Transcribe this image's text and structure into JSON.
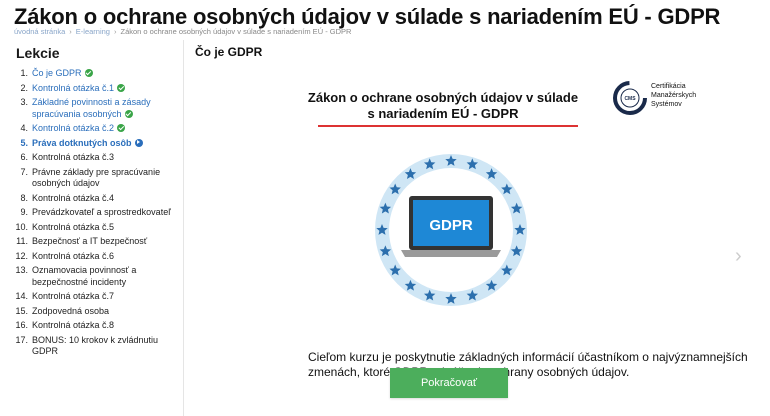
{
  "page": {
    "title": "Zákon o ochrane osobných údajov v súlade s nariadením EÚ - GDPR"
  },
  "breadcrumb": {
    "items": [
      "úvodná stránka",
      "E-learning",
      "Zákon o ochrane osobných údajov v súlade s nariadením EÚ - GDPR"
    ]
  },
  "sidebar": {
    "title": "Lekcie",
    "items": [
      {
        "num": "1.",
        "label": "Čo je GDPR",
        "status": "done"
      },
      {
        "num": "2.",
        "label": "Kontrolná otázka č.1",
        "status": "done"
      },
      {
        "num": "3.",
        "label": "Základné povinnosti a zásady spracúvania osobných",
        "status": "done"
      },
      {
        "num": "4.",
        "label": "Kontrolná otázka č.2",
        "status": "done"
      },
      {
        "num": "5.",
        "label": "Práva dotknutých osôb",
        "status": "active"
      },
      {
        "num": "6.",
        "label": "Kontrolná otázka č.3",
        "status": "none"
      },
      {
        "num": "7.",
        "label": "Právne základy pre spracúvanie osobných údajov",
        "status": "none"
      },
      {
        "num": "8.",
        "label": "Kontrolná otázka č.4",
        "status": "none"
      },
      {
        "num": "9.",
        "label": "Prevádzkovateľ a sprostredkovateľ",
        "status": "none"
      },
      {
        "num": "10.",
        "label": "Kontrolná otázka č.5",
        "status": "none"
      },
      {
        "num": "11.",
        "label": "Bezpečnosť a IT bezpečnosť",
        "status": "none"
      },
      {
        "num": "12.",
        "label": "Kontrolná otázka č.6",
        "status": "none"
      },
      {
        "num": "13.",
        "label": "Oznamovacia povinnosť a bezpečnostné incidenty",
        "status": "none"
      },
      {
        "num": "14.",
        "label": "Kontrolná otázka č.7",
        "status": "none"
      },
      {
        "num": "15.",
        "label": "Zodpovedná osoba",
        "status": "none"
      },
      {
        "num": "16.",
        "label": "Kontrolná otázka č.8",
        "status": "none"
      },
      {
        "num": "17.",
        "label": "BONUS: 10 krokov k zvládnutiu GDPR",
        "status": "none"
      }
    ]
  },
  "main": {
    "section_title": "Čo je GDPR",
    "slide": {
      "title": "Zákon o ochrane osobných údajov v súlade s nariadením EÚ - GDPR",
      "logo_lines": [
        "Certifikácia",
        "Manažérskych",
        "Systémov"
      ],
      "laptop_label": "GDPR",
      "body": "Cieľom kurzu je poskytnutie základných informácií účastníkom o najvýznamnejších zmenách, ktoré GDPR prináša do ochrany osobných údajov."
    },
    "continue_label": "Pokračovať"
  },
  "colors": {
    "accent_blue": "#2a6ebb",
    "done_green": "#3aa548",
    "button_green": "#4cae5c",
    "badge_blue": "#5aa3d6",
    "star_blue": "#2c6fad"
  }
}
